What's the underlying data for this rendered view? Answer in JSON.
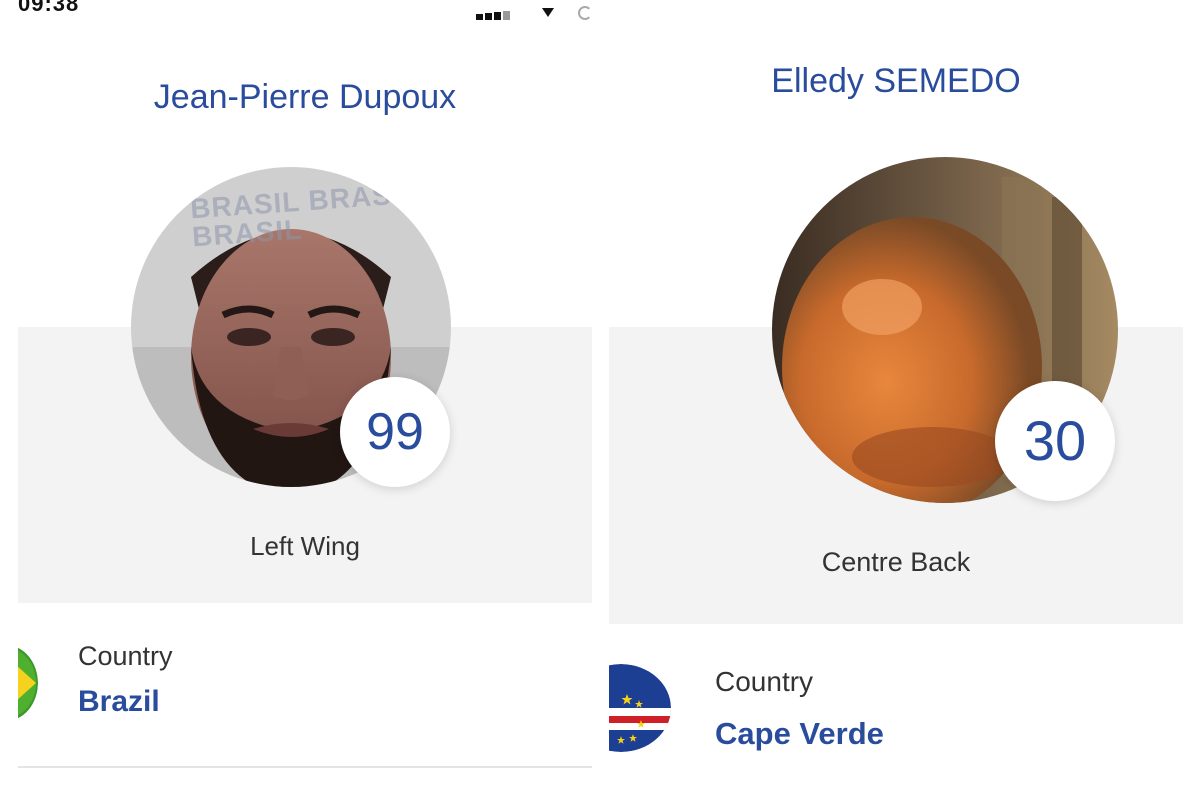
{
  "status_bar": {
    "time": "09:38"
  },
  "players": [
    {
      "name": "Jean-Pierre Dupoux",
      "number": "99",
      "position": "Left Wing",
      "country_label": "Country",
      "country": "Brazil",
      "flag_icon": "brazil-flag-icon",
      "photo_overlay_text": "BRASIL BRASIL BRASIL"
    },
    {
      "name": "Elledy SEMEDO",
      "number": "30",
      "position": "Centre Back",
      "country_label": "Country",
      "country": "Cape Verde",
      "flag_icon": "cape-verde-flag-icon"
    }
  ],
  "colors": {
    "accent": "#2a4c9c",
    "band": "#f3f3f3",
    "divider": "#e4e4e4",
    "brazil_green": "#3d9a2a",
    "brazil_yellow": "#f4d21e",
    "cape_verde_blue": "#1c3f94",
    "cape_verde_red": "#cf2027",
    "cape_verde_star": "#f7d116"
  }
}
